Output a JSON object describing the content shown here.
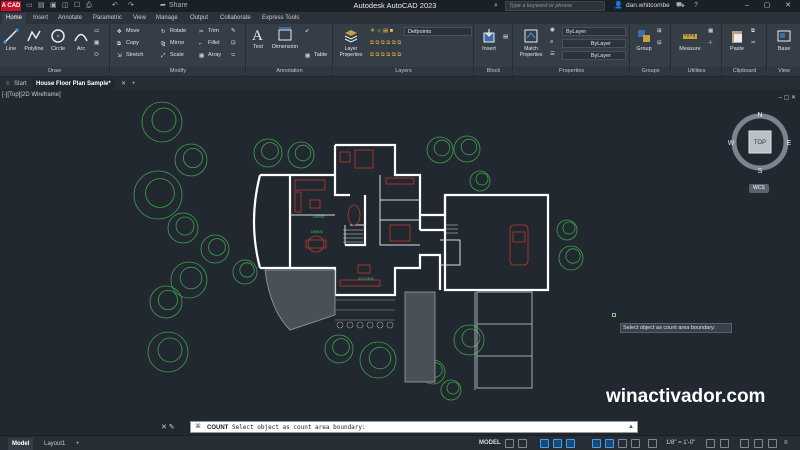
{
  "titlebar": {
    "logo": "A CAD",
    "quick_share": "Share",
    "app_title": "Autodesk AutoCAD 2023",
    "search_placeholder": "Type a keyword or phrase",
    "user": "dan.whitcombe"
  },
  "ribbon_tabs": [
    "Home",
    "Insert",
    "Annotate",
    "Parametric",
    "View",
    "Manage",
    "Output",
    "Collaborate",
    "Express Tools"
  ],
  "ribbon": {
    "draw": {
      "title": "Draw",
      "line": "Line",
      "polyline": "Polyline",
      "circle": "Circle",
      "arc": "Arc"
    },
    "modify": {
      "title": "Modify",
      "move": "Move",
      "rotate": "Rotate",
      "trim": "Trim",
      "copy": "Copy",
      "mirror": "Mirror",
      "fillet": "Fillet",
      "stretch": "Stretch",
      "scale": "Scale",
      "array": "Array"
    },
    "annotation": {
      "title": "Annotation",
      "text": "Text",
      "dimension": "Dimension",
      "table": "Table"
    },
    "layers": {
      "title": "Layers",
      "layer_properties": "Layer Properties",
      "current_layer": "Defpoints"
    },
    "block": {
      "title": "Block",
      "insert": "Insert"
    },
    "properties": {
      "title": "Properties",
      "match": "Match Properties",
      "color": "ByLayer",
      "linetype": "ByLayer",
      "lineweight": "ByLayer"
    },
    "groups": {
      "title": "Groups",
      "group": "Group"
    },
    "utilities": {
      "title": "Utilities",
      "measure": "Measure"
    },
    "clipboard": {
      "title": "Clipboard",
      "paste": "Paste"
    },
    "view": {
      "title": "View",
      "base": "Base"
    }
  },
  "doc_tabs": [
    "Start",
    "House Floor Plan Sample*"
  ],
  "viewport_label": "[-][Top][2D Wireframe]",
  "viewcube": {
    "n": "N",
    "s": "S",
    "e": "E",
    "w": "W",
    "top": "TOP",
    "wcs": "WCS"
  },
  "room_labels": [
    "LIVING",
    "DINING",
    "KITCHEN"
  ],
  "tooltip": "Select object as count area boundary:",
  "command": {
    "name": "COUNT",
    "prompt": "Select object as count area boundary:"
  },
  "layout_tabs": [
    "Model",
    "Layout1"
  ],
  "status": {
    "model": "MODEL",
    "scale": "1/8\" = 1'-0\""
  },
  "watermark": "winactivador.com",
  "colors": {
    "canvas": "#212830",
    "ribbon": "#353d46",
    "walls": "#ffffff",
    "furniture": "#c0392b",
    "trees": "#3fa34d",
    "accent": "#3ba0ff"
  }
}
